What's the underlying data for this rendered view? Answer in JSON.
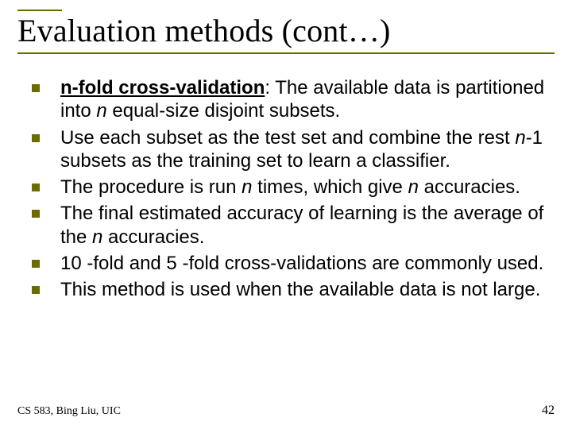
{
  "title": "Evaluation methods (cont…)",
  "bullets": {
    "b0": {
      "bold_u": "n-fold cross-validation",
      "colon": ": The available data is partitioned into ",
      "it1": "n",
      "rest1": " equal-size disjoint subsets."
    },
    "b1": {
      "pre": "Use each subset as the test set and combine the rest ",
      "it1": "n",
      "mid": "-1 subsets as the training set to learn a classifier."
    },
    "b2": {
      "pre": "The procedure is run ",
      "it1": "n",
      "mid": " times, which give ",
      "it2": "n",
      "rest": " accuracies."
    },
    "b3": {
      "pre": "The final estimated accuracy of learning is the average of the ",
      "it1": "n",
      "rest": " accuracies."
    },
    "b4": "10 -fold and 5 -fold cross-validations are commonly used.",
    "b5": "This method is used when the available data is not large."
  },
  "footer_left": "CS 583, Bing Liu, UIC",
  "footer_right": "42"
}
